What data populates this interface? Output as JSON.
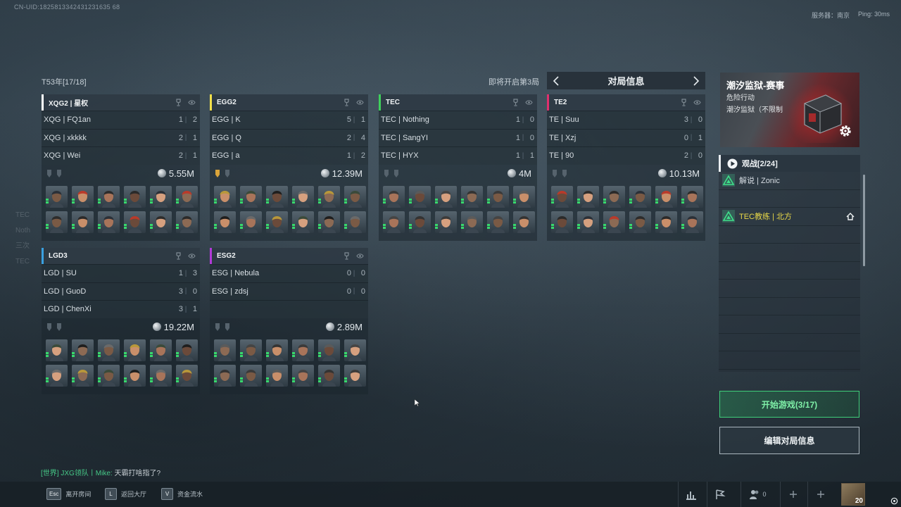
{
  "header": {
    "uid": "CN-UID:1825813342431231635 68",
    "server_label": "服务器：南京",
    "ping": "Ping: 30ms"
  },
  "season": "T53年[17/18]",
  "round_label": "即将开启第3局",
  "info_nav": {
    "title": "对局信息"
  },
  "teams": [
    {
      "name": "XQG2 | 星权",
      "accent": "#ffffff",
      "money": "5.55M",
      "players": [
        {
          "name": "XQG | FQ1an",
          "k": "1",
          "d": "2"
        },
        {
          "name": "XQG | xkkkk",
          "k": "2",
          "d": "1"
        },
        {
          "name": "XQG | Wei",
          "k": "2",
          "d": "1"
        }
      ]
    },
    {
      "name": "EGG2",
      "accent": "#f2e04a",
      "money": "12.39M",
      "players": [
        {
          "name": "EGG | K",
          "k": "5",
          "d": "1"
        },
        {
          "name": "EGG | Q",
          "k": "2",
          "d": "4"
        },
        {
          "name": "EGG | a",
          "k": "1",
          "d": "2"
        }
      ]
    },
    {
      "name": "TEC",
      "accent": "#3fd05c",
      "money": "4M",
      "players": [
        {
          "name": "TEC | Nothing",
          "k": "1",
          "d": "0"
        },
        {
          "name": "TEC | SangYI",
          "k": "1",
          "d": "0"
        },
        {
          "name": "TEC | HYX",
          "k": "1",
          "d": "1"
        }
      ]
    },
    {
      "name": "TE2",
      "accent": "#e0306e",
      "money": "10.13M",
      "players": [
        {
          "name": "TE | Suu",
          "k": "3",
          "d": "0"
        },
        {
          "name": "TE | Xzj",
          "k": "0",
          "d": "1"
        },
        {
          "name": "TE | 90",
          "k": "2",
          "d": "0"
        }
      ]
    },
    {
      "name": "LGD3",
      "accent": "#3aa0e0",
      "money": "19.22M",
      "players": [
        {
          "name": "LGD | SU",
          "k": "1",
          "d": "3"
        },
        {
          "name": "LGD | GuoD",
          "k": "3",
          "d": "0"
        },
        {
          "name": "LGD | ChenXi",
          "k": "3",
          "d": "1"
        }
      ]
    },
    {
      "name": "ESG2",
      "accent": "#b23ad8",
      "money": "2.89M",
      "players": [
        {
          "name": "ESG | Nebula",
          "k": "0",
          "d": "0"
        },
        {
          "name": "ESG | zdsj",
          "k": "0",
          "d": "0"
        },
        {
          "name": "",
          "k": "",
          "d": ""
        }
      ]
    }
  ],
  "event": {
    "title": "潮汐监狱-赛事",
    "mode": "危险行动",
    "map": "潮汐监狱（不限制"
  },
  "spectate": {
    "label": "观战[2/24]",
    "slots": [
      {
        "name": "解说 | Zonic",
        "color": "#d6dde3"
      },
      {
        "name": "",
        "color": "#d6dde3"
      },
      {
        "name": "TEC教练 | 北方",
        "color": "#e8d848"
      },
      {
        "name": "",
        "color": "#d6dde3"
      },
      {
        "name": "",
        "color": "#d6dde3"
      },
      {
        "name": "",
        "color": "#d6dde3"
      },
      {
        "name": "",
        "color": "#d6dde3"
      },
      {
        "name": "",
        "color": "#d6dde3"
      },
      {
        "name": "",
        "color": "#d6dde3"
      },
      {
        "name": "",
        "color": "#d6dde3"
      },
      {
        "name": "",
        "color": "#d6dde3"
      }
    ]
  },
  "buttons": {
    "start": "开始游戏(3/17)",
    "edit": "编辑对局信息"
  },
  "chat": {
    "channel": "[世界]",
    "sender": "JXG领队丨Mike:",
    "message": "天霸打啥指了?"
  },
  "bottom": {
    "hints": [
      {
        "key": "Esc",
        "label": "离开房间"
      },
      {
        "key": "L",
        "label": "返回大厅"
      },
      {
        "key": "V",
        "label": "资金流水"
      }
    ],
    "party_count": "0",
    "player_level": "20"
  },
  "colors": {
    "accent_green": "#3fd07a",
    "panel": "#2a3640"
  }
}
